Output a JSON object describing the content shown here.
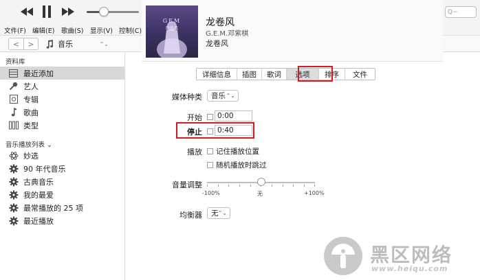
{
  "player": {
    "controls": [
      "previous-icon",
      "pause-icon",
      "next-icon"
    ],
    "volume_level": 0.33
  },
  "search": {
    "placeholder": "Q~"
  },
  "menu": {
    "items": [
      "文件(F)",
      "编辑(E)",
      "歌曲(S)",
      "显示(V)",
      "控制(C)"
    ]
  },
  "nav": {
    "back": "<",
    "forward": ">",
    "media_kind": "音乐",
    "media_icon": "music-note-icon"
  },
  "sidebar": {
    "library_heading": "资料库",
    "library_items": [
      {
        "label": "最近添加",
        "icon": "grid-icon",
        "selected": true
      },
      {
        "label": "艺人",
        "icon": "microphone-icon"
      },
      {
        "label": "专辑",
        "icon": "album-icon"
      },
      {
        "label": "歌曲",
        "icon": "music-note-icon"
      },
      {
        "label": "类型",
        "icon": "genre-icon"
      }
    ],
    "playlists_heading": "音乐播放列表 ⌄",
    "playlist_items": [
      {
        "label": "妙选",
        "icon": "atom-icon"
      },
      {
        "label": "90 年代音乐",
        "icon": "gear-icon"
      },
      {
        "label": "古典音乐",
        "icon": "gear-icon"
      },
      {
        "label": "我的最爱",
        "icon": "gear-icon"
      },
      {
        "label": "最常播放的 25 项",
        "icon": "gear-icon"
      },
      {
        "label": "最近播放",
        "icon": "gear-icon"
      }
    ]
  },
  "song": {
    "title": "龙卷风",
    "artist": "G.E.M.邓紫棋",
    "album": "龙卷风",
    "artwork_text_top": "GEM",
    "artwork_text_bottom": "龍捲風"
  },
  "tabs": {
    "items": [
      "详细信息",
      "插图",
      "歌词",
      "选项",
      "排序",
      "文件"
    ],
    "active": "选项"
  },
  "options": {
    "media_kind_label": "媒体种类",
    "media_kind_value": "音乐",
    "start_label": "开始",
    "start_value": "0:00",
    "start_checked": false,
    "stop_label": "停止",
    "stop_value": "0:40",
    "stop_checked": false,
    "playback_label": "播放",
    "remember_position": "记住播放位置",
    "skip_when_shuffling": "随机播放时跳过",
    "volume_label": "音量调整",
    "volume_min": "-100%",
    "volume_mid": "无",
    "volume_max": "+100%",
    "volume_adjust": 0.5,
    "eq_label": "均衡器",
    "eq_value": "无"
  },
  "watermark": {
    "text": "黑区网络",
    "url": "www.heiqu.com"
  },
  "colors": {
    "highlight_red": "#d8191f",
    "selected_row": "#d8d8d8"
  }
}
